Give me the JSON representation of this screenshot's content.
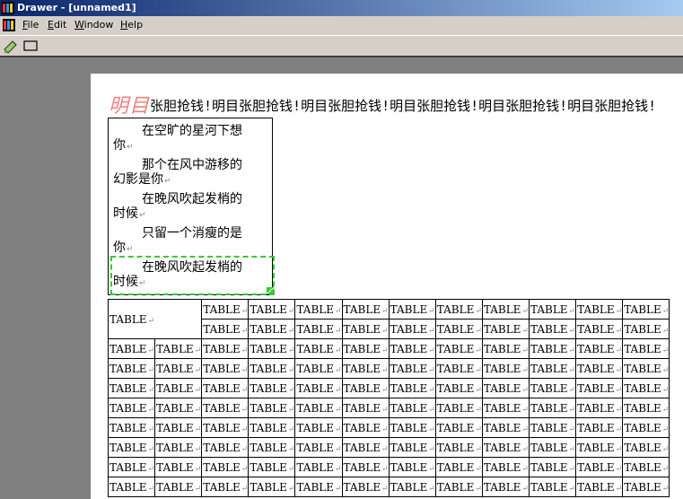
{
  "window": {
    "title": "Drawer - [unnamed1]"
  },
  "menu": {
    "items": [
      {
        "key": "F",
        "rest": "ile"
      },
      {
        "key": "E",
        "rest": "dit"
      },
      {
        "key": "W",
        "rest": "indow"
      },
      {
        "key": "H",
        "rest": "elp"
      }
    ]
  },
  "toolbar": {
    "tools": [
      "pencil-eraser-icon",
      "rectangle-icon"
    ]
  },
  "document": {
    "heading_big": "明目",
    "heading_rest": "张胆抢钱!明目张胆抢钱!明目张胆抢钱!明目张胆抢钱!明目张胆抢钱!明目张胆抢钱!",
    "poem_lines": [
      "在空旷的星河下想",
      "你",
      "那个在风中游移的",
      "幻影是你",
      "在晚风吹起发梢的",
      "时候",
      "只留一个消瘦的是",
      "你",
      "在晚风吹起发梢的",
      "时候"
    ],
    "return_mark": "↵",
    "table_cell": "TABLE",
    "table_rows": 10,
    "table_cols": 12
  },
  "colors": {
    "title_start": "#0a246a",
    "title_end": "#a6caf0",
    "selection": "#33cc33",
    "heading_big": "#f08080"
  }
}
